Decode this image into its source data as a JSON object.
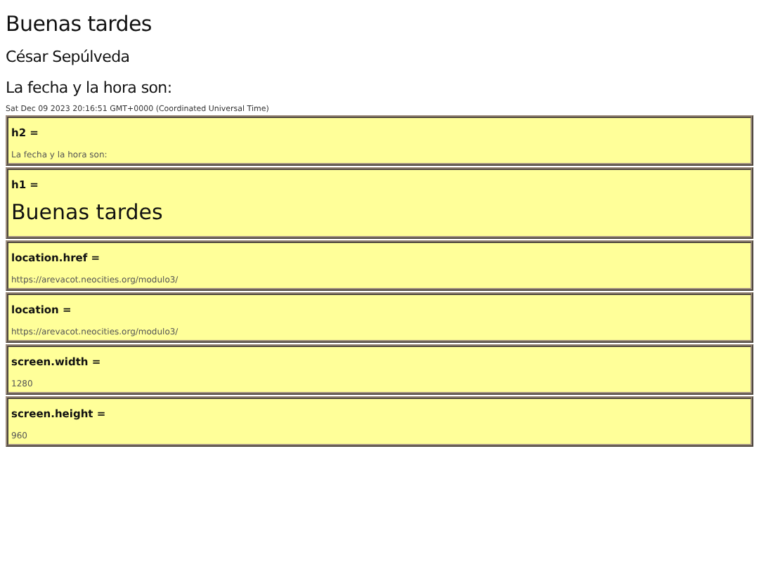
{
  "heading": "Buenas tardes",
  "author": "César Sepúlveda",
  "subheading": "La fecha y la hora son:",
  "datetime": "Sat Dec 09 2023 20:16:51 GMT+0000 (Coordinated Universal Time)",
  "boxes": [
    {
      "label": "h2 =",
      "value": "La fecha y la hora son:",
      "kind": "small"
    },
    {
      "label": "h1 =",
      "value": "Buenas tardes",
      "kind": "large"
    },
    {
      "label": "location.href =",
      "value": "https://arevacot.neocities.org/modulo3/",
      "kind": "small"
    },
    {
      "label": "location =",
      "value": "https://arevacot.neocities.org/modulo3/",
      "kind": "small"
    },
    {
      "label": "screen.width =",
      "value": "1280",
      "kind": "small"
    },
    {
      "label": "screen.height =",
      "value": "960",
      "kind": "small"
    }
  ]
}
